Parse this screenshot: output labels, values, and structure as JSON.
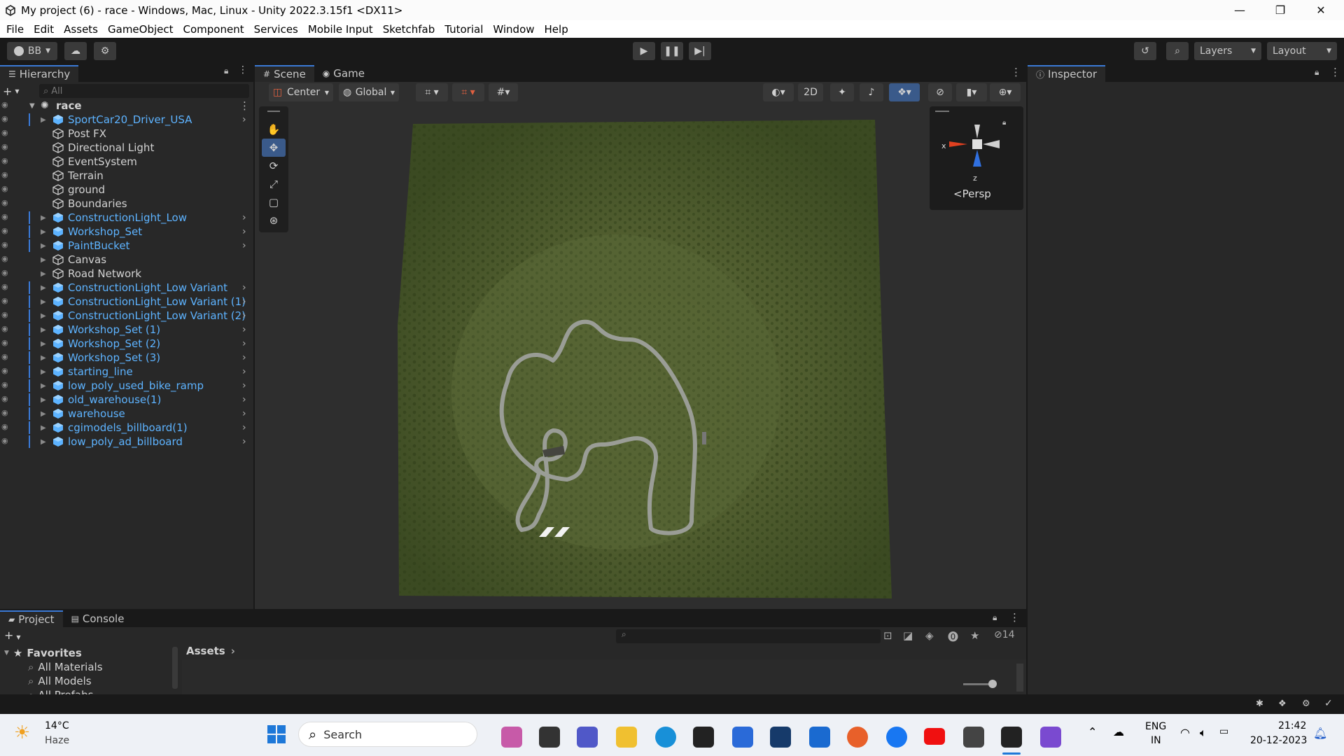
{
  "window": {
    "title": "My project (6) - race - Windows, Mac, Linux - Unity 2022.3.15f1 <DX11>",
    "controls": {
      "minimize": "—",
      "maximize": "❐",
      "close": "✕"
    }
  },
  "menu": [
    "File",
    "Edit",
    "Assets",
    "GameObject",
    "Component",
    "Services",
    "Mobile Input",
    "Sketchfab",
    "Tutorial",
    "Window",
    "Help"
  ],
  "toolbar": {
    "account": "BB",
    "layers_label": "Layers",
    "layout_label": "Layout"
  },
  "hierarchy": {
    "tab": "Hierarchy",
    "search_placeholder": "All",
    "scene_name": "race",
    "items": [
      {
        "label": "SportCar20_Driver_USA",
        "prefab": true,
        "expand": true
      },
      {
        "label": "Post FX",
        "prefab": false,
        "expand": false
      },
      {
        "label": "Directional Light",
        "prefab": false,
        "expand": false
      },
      {
        "label": "EventSystem",
        "prefab": false,
        "expand": false
      },
      {
        "label": "Terrain",
        "prefab": false,
        "expand": false
      },
      {
        "label": "ground",
        "prefab": false,
        "expand": false
      },
      {
        "label": "Boundaries",
        "prefab": false,
        "expand": false
      },
      {
        "label": "ConstructionLight_Low",
        "prefab": true,
        "expand": true
      },
      {
        "label": "Workshop_Set",
        "prefab": true,
        "expand": true
      },
      {
        "label": "PaintBucket",
        "prefab": true,
        "expand": true
      },
      {
        "label": "Canvas",
        "prefab": false,
        "expand": true
      },
      {
        "label": "Road Network",
        "prefab": false,
        "expand": true
      },
      {
        "label": "ConstructionLight_Low Variant",
        "prefab": true,
        "expand": true
      },
      {
        "label": "ConstructionLight_Low Variant (1)",
        "prefab": true,
        "expand": true
      },
      {
        "label": "ConstructionLight_Low Variant (2)",
        "prefab": true,
        "expand": true
      },
      {
        "label": "Workshop_Set (1)",
        "prefab": true,
        "expand": true
      },
      {
        "label": "Workshop_Set (2)",
        "prefab": true,
        "expand": true
      },
      {
        "label": "Workshop_Set (3)",
        "prefab": true,
        "expand": true
      },
      {
        "label": "starting_line",
        "prefab": true,
        "expand": true
      },
      {
        "label": "low_poly_used_bike_ramp",
        "prefab": true,
        "expand": true
      },
      {
        "label": "old_warehouse(1)",
        "prefab": true,
        "expand": true
      },
      {
        "label": "warehouse",
        "prefab": true,
        "expand": true
      },
      {
        "label": "cgimodels_billboard(1)",
        "prefab": true,
        "expand": true
      },
      {
        "label": "low_poly_ad_billboard",
        "prefab": true,
        "expand": true
      }
    ]
  },
  "scene": {
    "tabs": [
      "Scene",
      "Game"
    ],
    "pivot": "Center",
    "space": "Global",
    "mode_2d": "2D",
    "gizmo_x": "x",
    "gizmo_z": "z",
    "persp": "Persp"
  },
  "inspector": {
    "tab": "Inspector"
  },
  "project": {
    "tabs": [
      "Project",
      "Console"
    ],
    "favorites": "Favorites",
    "fav_items": [
      "All Materials",
      "All Models",
      "All Prefabs"
    ],
    "assets_path": "Assets",
    "hidden_count": "14"
  },
  "taskbar": {
    "temp": "14°C",
    "weather": "Haze",
    "search_placeholder": "Search",
    "lang1": "ENG",
    "lang2": "IN",
    "time": "21:42",
    "date": "20-12-2023"
  },
  "colors": {
    "prefab": "#5db3ff",
    "accent": "#3a7ad6",
    "terrain": "#4e5a30"
  }
}
